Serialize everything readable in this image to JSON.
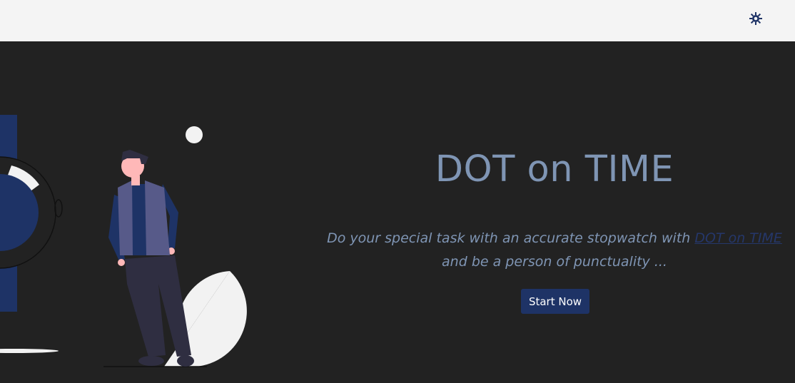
{
  "navbar": {
    "theme_toggle_icon": "sun-gear-icon"
  },
  "hero": {
    "title": "DOT on TIME",
    "text_before": "Do your special task with an accurate stopwatch with ",
    "link_text": "DOT on TIME",
    "text_after": " and be a person of punctuality ...",
    "button_label": "Start Now"
  },
  "illustration": {
    "name": "person-with-stopwatch-illustration"
  },
  "colors": {
    "navbar_bg": "#f4f4f4",
    "hero_bg": "#222222",
    "title": "#7f95b4",
    "link": "#25376a",
    "button_bg": "#1e3366",
    "button_text": "#ffffff",
    "icon": "#1e3366"
  }
}
